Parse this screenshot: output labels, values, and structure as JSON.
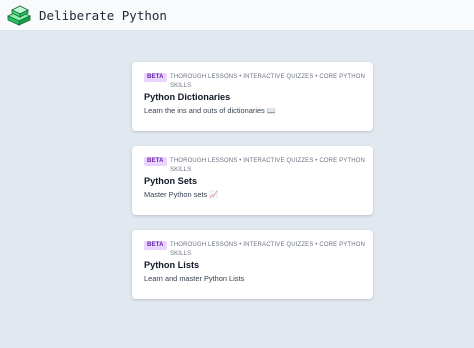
{
  "header": {
    "brand": "Deliberate Python",
    "logo_icon": "green-blocks-logo-icon",
    "accent_color": "#4ade80"
  },
  "courses": [
    {
      "badge": "BETA",
      "meta": "THOROUGH LESSONS • INTERACTIVE QUIZZES • CORE PYTHON SKILLS",
      "title": "Python Dictionaries",
      "description": "Learn the ins and outs of dictionaries",
      "emoji": "📖"
    },
    {
      "badge": "BETA",
      "meta": "THOROUGH LESSONS • INTERACTIVE QUIZZES • CORE PYTHON SKILLS",
      "title": "Python Sets",
      "description": "Master Python sets",
      "emoji": "📈"
    },
    {
      "badge": "BETA",
      "meta": "THOROUGH LESSONS • INTERACTIVE QUIZZES • CORE PYTHON SKILLS",
      "title": "Python Lists",
      "description": "Learn and master Python Lists",
      "emoji": ""
    }
  ],
  "colors": {
    "background": "#e2e8f0",
    "badge_bg": "#e9d5ff",
    "badge_text": "#6b21a8"
  }
}
